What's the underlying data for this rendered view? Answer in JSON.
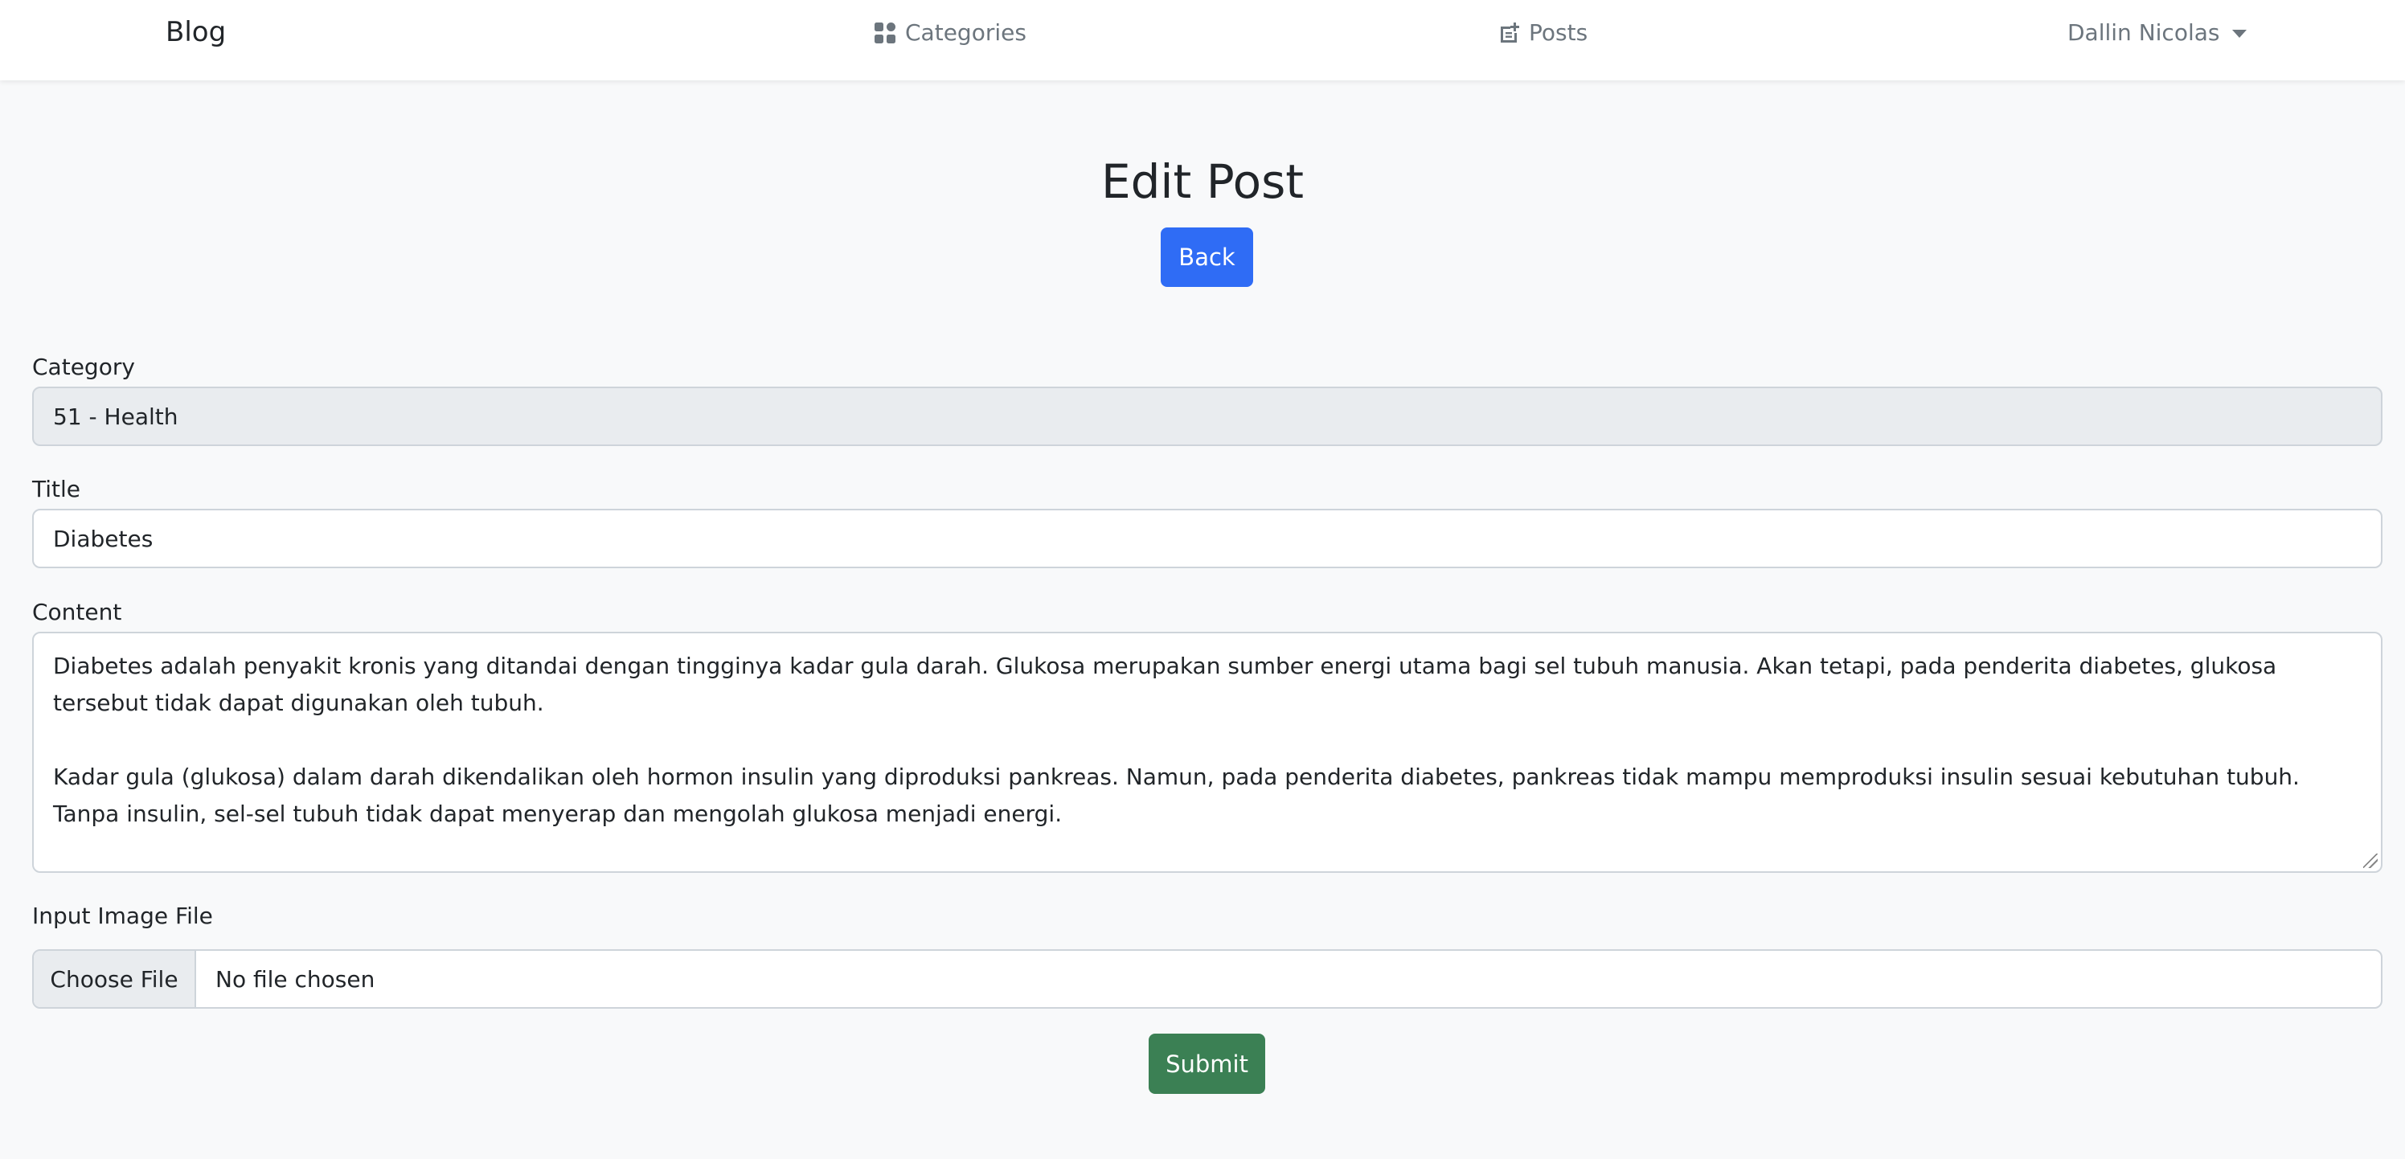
{
  "navbar": {
    "brand": "Blog",
    "categories_label": "Categories",
    "posts_label": "Posts",
    "user_name": "Dallin Nicolas"
  },
  "header": {
    "title": "Edit Post",
    "back_label": "Back"
  },
  "form": {
    "category_label": "Category",
    "category_value": "51 - Health",
    "title_label": "Title",
    "title_value": "Diabetes",
    "content_label": "Content",
    "content_paragraph_1": "Diabetes adalah penyakit kronis yang ditandai dengan tingginya kadar gula darah. Glukosa merupakan sumber energi utama bagi sel tubuh manusia. Akan tetapi, pada penderita diabetes, glukosa tersebut tidak dapat digunakan oleh tubuh.",
    "content_paragraph_2": "Kadar gula (glukosa) dalam darah dikendalikan oleh hormon insulin yang diproduksi pankreas. Namun, pada penderita diabetes, pankreas tidak mampu memproduksi insulin sesuai kebutuhan tubuh. Tanpa insulin, sel-sel tubuh tidak dapat menyerap dan mengolah glukosa menjadi energi.",
    "image_label": "Input Image File",
    "choose_file_label": "Choose File",
    "file_status": "No file chosen",
    "submit_label": "Submit"
  },
  "colors": {
    "primary": "#2f6cf5",
    "success": "#3b8054",
    "background": "#f8f9fa",
    "nav_text": "#6c757d"
  },
  "icons": {
    "categories": "grid-icon",
    "posts": "post-add-icon",
    "user": "chevron-down-icon"
  }
}
